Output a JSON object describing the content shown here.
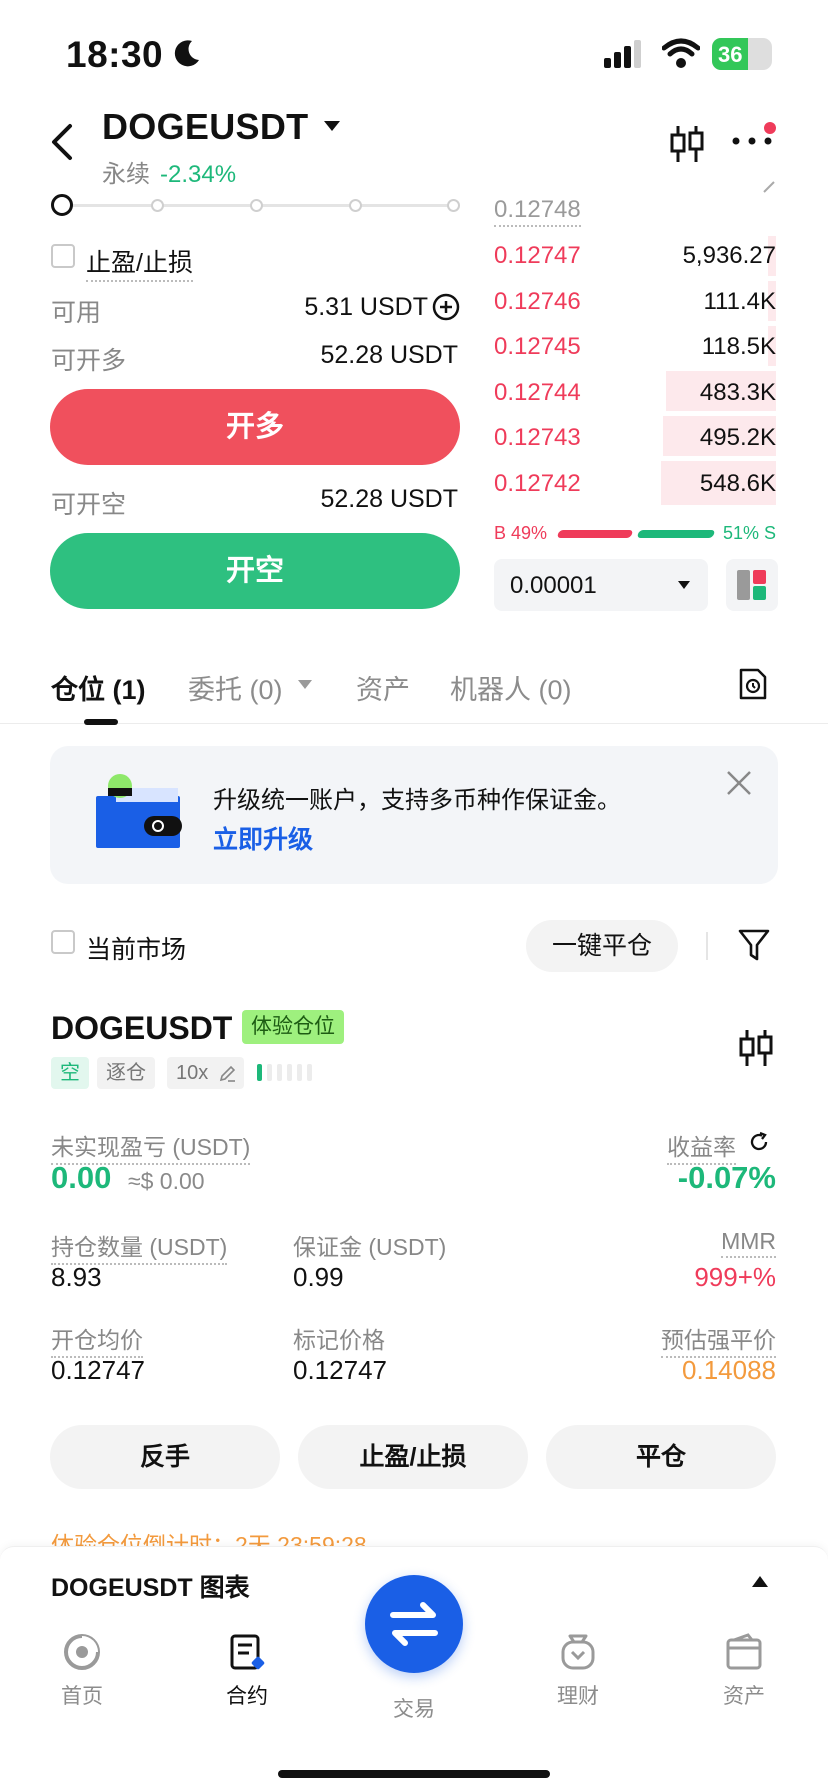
{
  "status": {
    "time": "18:30",
    "battery": "36"
  },
  "header": {
    "symbol": "DOGEUSDT",
    "contract_type": "永续",
    "change": "-2.34%"
  },
  "order_form": {
    "tpsl_label": "止盈/止损",
    "available_label": "可用",
    "available_value": "5.31 USDT",
    "open_long_label": "可开多",
    "open_long_value": "52.28 USDT",
    "long_button": "开多",
    "open_short_label": "可开空",
    "open_short_value": "52.28 USDT",
    "short_button": "开空"
  },
  "order_book": {
    "last_price": "0.12748",
    "asks": [
      {
        "price": "0.12747",
        "qty": "5,936.27"
      },
      {
        "price": "0.12746",
        "qty": "111.4K"
      },
      {
        "price": "0.12745",
        "qty": "118.5K"
      },
      {
        "price": "0.12744",
        "qty": "483.3K"
      },
      {
        "price": "0.12743",
        "qty": "495.2K"
      },
      {
        "price": "0.12742",
        "qty": "548.6K"
      }
    ],
    "buy_ratio": "B 49%",
    "sell_ratio": "51% S",
    "buy_pct": 49,
    "precision": "0.00001"
  },
  "tabs": {
    "positions": "仓位 (1)",
    "orders": "委托 (0)",
    "assets": "资产",
    "bots": "机器人 (0)"
  },
  "banner": {
    "text": "升级统一账户，支持多币种作保证金。",
    "link": "立即升级"
  },
  "filter": {
    "current_market": "当前市场",
    "close_all": "一键平仓"
  },
  "position": {
    "symbol": "DOGEUSDT",
    "badge": "体验仓位",
    "side": "空",
    "margin_mode": "逐仓",
    "leverage": "10x",
    "upnl_label": "未实现盈亏 (USDT)",
    "upnl_value": "0.00",
    "upnl_usd": "≈$ 0.00",
    "roe_label": "收益率",
    "roe_value": "-0.07%",
    "size_label": "持仓数量 (USDT)",
    "size_value": "8.93",
    "margin_label": "保证金 (USDT)",
    "margin_value": "0.99",
    "mmr_label": "MMR",
    "mmr_value": "999+%",
    "entry_label": "开仓均价",
    "entry_value": "0.12747",
    "mark_label": "标记价格",
    "mark_value": "0.12747",
    "liq_label": "预估强平价",
    "liq_value": "0.14088",
    "btn_reverse": "反手",
    "btn_tpsl": "止盈/止损",
    "btn_close": "平仓",
    "countdown": "体验仓位倒计时：2天 23:59:28"
  },
  "chart_bar": {
    "title": "DOGEUSDT 图表"
  },
  "nav": {
    "home": "首页",
    "futures": "合约",
    "trade": "交易",
    "earn": "理财",
    "assets": "资产"
  },
  "colors": {
    "up": "#ef3b5a",
    "down": "#1db87a",
    "brand": "#1a5fe6"
  }
}
